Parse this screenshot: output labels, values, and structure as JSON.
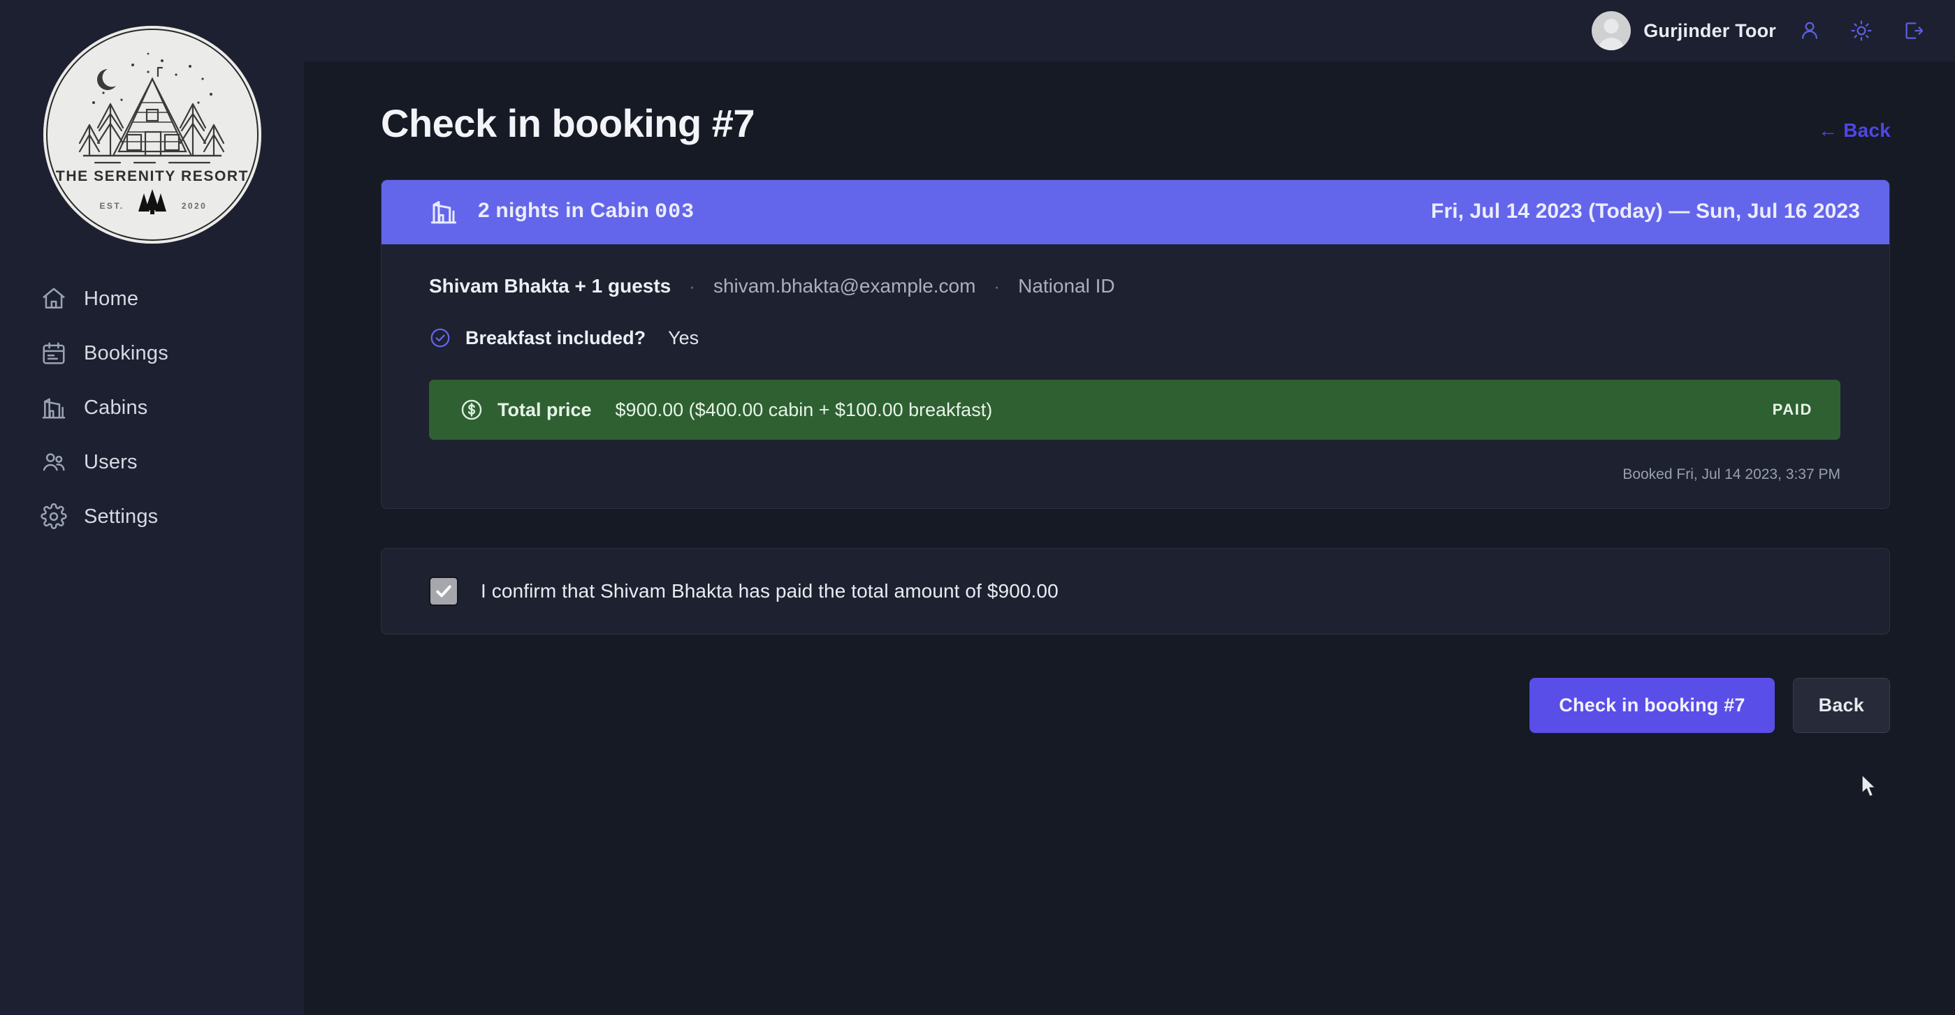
{
  "brand": {
    "logo_name": "THE SERENITY RESORT",
    "logo_est": "EST.",
    "logo_year": "2020"
  },
  "sidebar": {
    "items": [
      {
        "label": "Home",
        "icon": "home-icon"
      },
      {
        "label": "Bookings",
        "icon": "calendar-icon"
      },
      {
        "label": "Cabins",
        "icon": "cabin-icon"
      },
      {
        "label": "Users",
        "icon": "users-icon"
      },
      {
        "label": "Settings",
        "icon": "gear-icon"
      }
    ]
  },
  "topbar": {
    "user_name": "Gurjinder Toor",
    "icons": [
      "user-icon",
      "sun-icon",
      "logout-icon"
    ]
  },
  "page": {
    "title": "Check in booking #7",
    "back_link": "← Back"
  },
  "booking": {
    "banner": {
      "icon": "cabin-icon",
      "nights_text": "2 nights in Cabin",
      "cabin_number": "003",
      "dates": "Fri, Jul 14 2023 (Today) — Sun, Jul 16 2023"
    },
    "guest": {
      "name_and_guests": "Shivam Bhakta + 1 guests",
      "separator": "·",
      "email": "shivam.bhakta@example.com",
      "id_type": "National ID"
    },
    "breakfast": {
      "label": "Breakfast included?",
      "value": "Yes",
      "icon": "check-circle-icon"
    },
    "price": {
      "icon": "dollar-circle-icon",
      "label": "Total price",
      "value": "$900.00 ($400.00 cabin + $100.00 breakfast)",
      "status_badge": "PAID"
    },
    "booked_at": "Booked Fri, Jul 14 2023, 3:37 PM"
  },
  "confirm": {
    "checked": true,
    "label": "I confirm that Shivam Bhakta has paid the total amount of $900.00"
  },
  "actions": {
    "primary": "Check in booking #7",
    "secondary": "Back"
  },
  "colors": {
    "accent": "#6366ea",
    "primary_button": "#5a4ee8",
    "paid_green": "#2f6032",
    "page_bg": "#161a25",
    "sidebar_bg": "#1d2030",
    "card_bg": "#1e2130"
  }
}
